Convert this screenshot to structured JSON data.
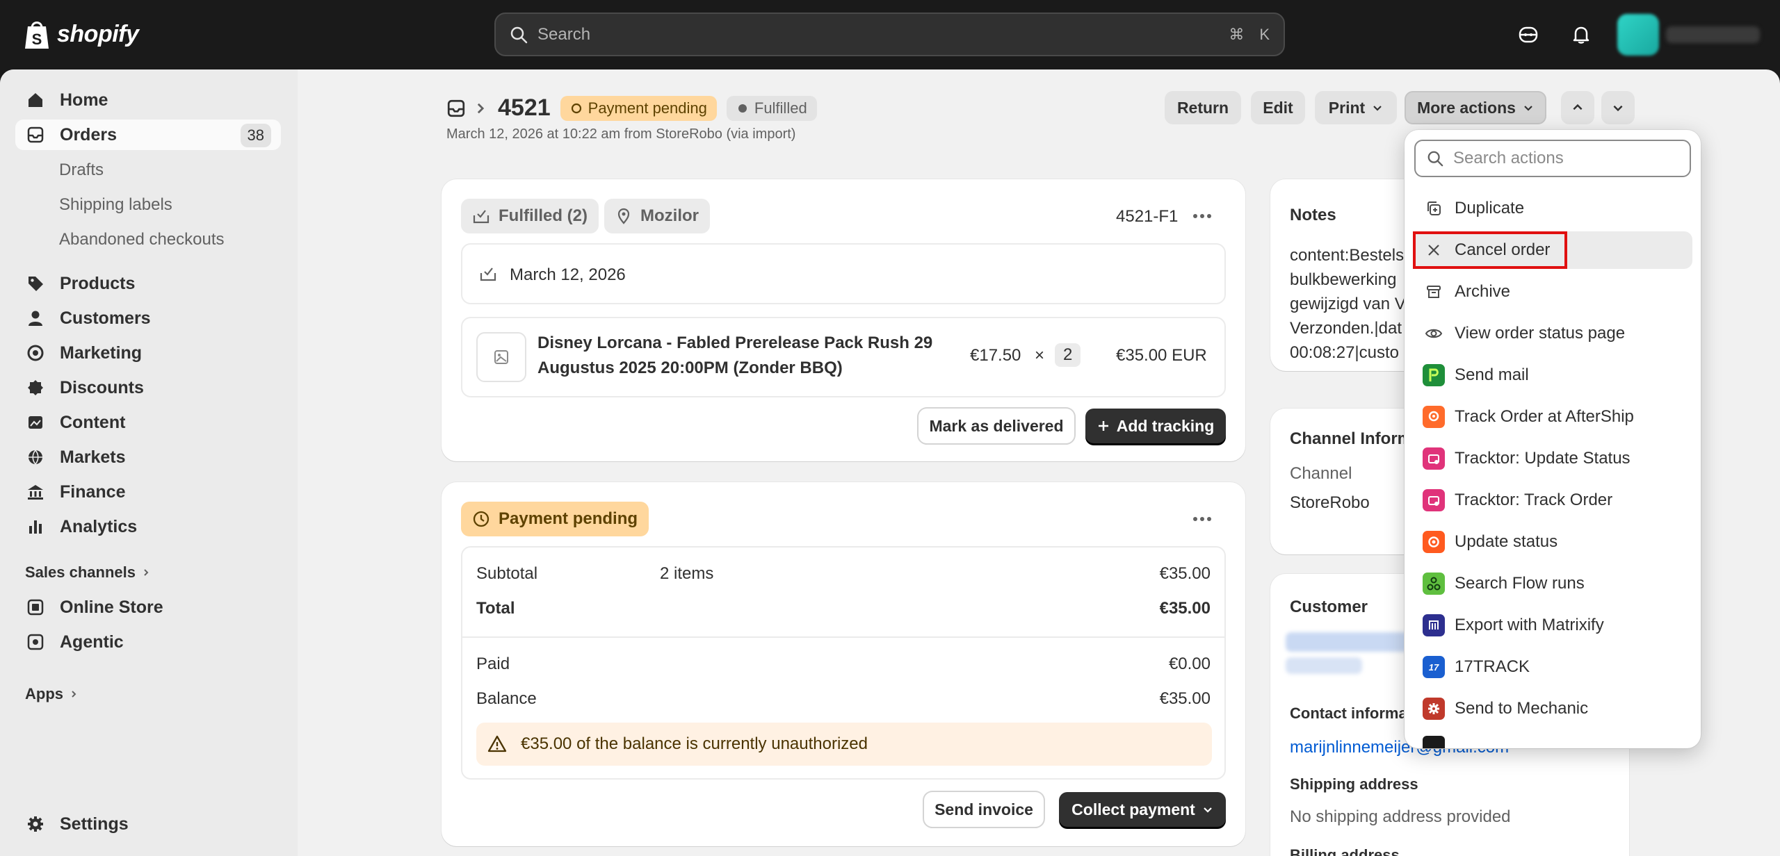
{
  "topbar": {
    "logo_text": "shopify",
    "search_placeholder": "Search",
    "shortcut_cmd": "⌘",
    "shortcut_key": "K"
  },
  "sidebar": {
    "items": [
      {
        "label": "Home",
        "icon": "home-icon"
      },
      {
        "label": "Orders",
        "icon": "orders-icon",
        "count": "38"
      },
      {
        "label": "Products",
        "icon": "tag-icon"
      },
      {
        "label": "Customers",
        "icon": "person-icon"
      },
      {
        "label": "Marketing",
        "icon": "target-icon"
      },
      {
        "label": "Discounts",
        "icon": "discount-icon"
      },
      {
        "label": "Content",
        "icon": "image-icon"
      },
      {
        "label": "Markets",
        "icon": "globe-icon"
      },
      {
        "label": "Finance",
        "icon": "bank-icon"
      },
      {
        "label": "Analytics",
        "icon": "bar-chart-icon"
      },
      {
        "label": "Online Store",
        "icon": "store-icon"
      },
      {
        "label": "Agentic",
        "icon": "agentic-icon"
      },
      {
        "label": "Settings",
        "icon": "gear-icon"
      }
    ],
    "order_subitems": [
      "Drafts",
      "Shipping labels",
      "Abandoned checkouts"
    ],
    "sales_channels_label": "Sales channels",
    "apps_label": "Apps"
  },
  "header": {
    "order_number": "4521",
    "payment_badge": "Payment pending",
    "fulfillment_badge": "Fulfilled",
    "subtitle": "March 12, 2026 at 10:22 am from StoreRobo (via import)",
    "buttons": {
      "return": "Return",
      "edit": "Edit",
      "print": "Print",
      "more_actions": "More actions"
    }
  },
  "fulfillment_card": {
    "status_pill": "Fulfilled (2)",
    "location_pill": "Mozilor",
    "fulfillment_id": "4521-F1",
    "date": "March 12, 2026",
    "product_line1": "Disney Lorcana - Fabled Prerelease Pack Rush 29",
    "product_line2": "Augustus 2025 20:00PM (Zonder BBQ)",
    "unit_price": "€17.50",
    "times": "×",
    "quantity": "2",
    "line_total": "€35.00 EUR",
    "mark_delivered": "Mark as delivered",
    "add_tracking": "Add tracking"
  },
  "payment_card": {
    "status_pill": "Payment pending",
    "subtotal_label": "Subtotal",
    "subtotal_items": "2 items",
    "subtotal_value": "€35.00",
    "total_label": "Total",
    "total_value": "€35.00",
    "paid_label": "Paid",
    "paid_value": "€0.00",
    "balance_label": "Balance",
    "balance_value": "€35.00",
    "warning": "€35.00 of the balance is currently unauthorized",
    "send_invoice": "Send invoice",
    "collect_payment": "Collect payment"
  },
  "notes_card": {
    "title": "Notes",
    "lines": [
      "content:Bestels",
      "bulkbewerking",
      "gewijzigd van V",
      "Verzonden.|dat",
      "00:08:27|custo"
    ]
  },
  "channel_card": {
    "title": "Channel Inform",
    "channel_label": "Channel",
    "channel_value": "StoreRobo"
  },
  "customer_card": {
    "title": "Customer",
    "contact_title": "Contact informa",
    "email": "marijnlinnemeijer@gmail.com",
    "shipping_title": "Shipping address",
    "shipping_value": "No shipping address provided",
    "billing_title": "Billing address"
  },
  "more_actions_menu": {
    "search_placeholder": "Search actions",
    "items": [
      {
        "label": "Duplicate",
        "icon": "duplicate-icon"
      },
      {
        "label": "Cancel order",
        "icon": "close-icon"
      },
      {
        "label": "Archive",
        "icon": "archive-icon"
      },
      {
        "label": "View order status page",
        "icon": "eye-icon"
      },
      {
        "label": "Send mail",
        "icon": "send-mail-app-icon",
        "color": "#1f8f3a"
      },
      {
        "label": "Track Order at AfterShip",
        "icon": "aftership-app-icon",
        "color": "#ff6b2b"
      },
      {
        "label": "Tracktor: Update Status",
        "icon": "tracktor-app-icon",
        "color": "#e0337a"
      },
      {
        "label": "Tracktor: Track Order",
        "icon": "tracktor-app-icon",
        "color": "#e0337a"
      },
      {
        "label": "Update status",
        "icon": "update-status-app-icon",
        "color": "#ff5a1f"
      },
      {
        "label": "Search Flow runs",
        "icon": "flow-app-icon",
        "color": "#5fbf3f"
      },
      {
        "label": "Export with Matrixify",
        "icon": "matrixify-app-icon",
        "color": "#2d2f8f"
      },
      {
        "label": "17TRACK",
        "icon": "17track-app-icon",
        "color": "#1a5fd0"
      },
      {
        "label": "Send to Mechanic",
        "icon": "mechanic-app-icon",
        "color": "#c0392b"
      }
    ]
  }
}
